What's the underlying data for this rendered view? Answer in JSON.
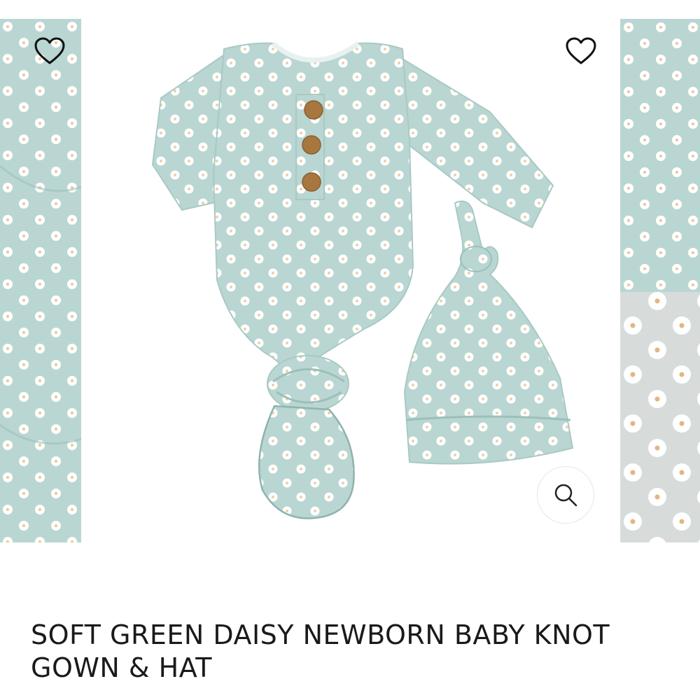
{
  "product": {
    "title": "SOFT GREEN DAISY NEWBORN BABY KNOT GOWN & HAT"
  },
  "gallery": {
    "fabric_color": "#b9d6d2",
    "flower_color": "#ffffff",
    "flower_center_color": "#e9c98f",
    "button_color": "#a8773f",
    "icons": {
      "wishlist": "heart-outline-icon",
      "zoom": "magnifier-icon"
    }
  }
}
